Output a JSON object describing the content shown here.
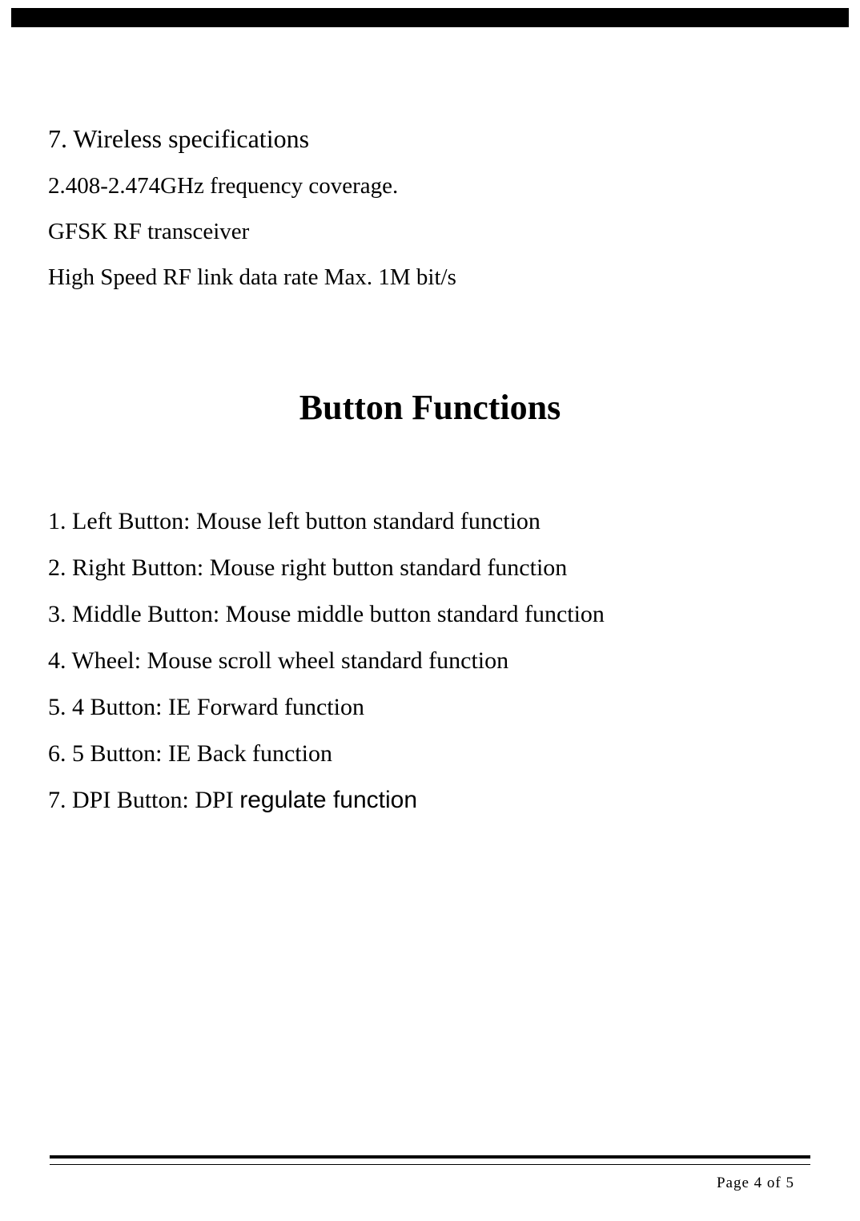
{
  "section": {
    "heading": "7. Wireless specifications",
    "specs": [
      "2.408-2.474GHz frequency coverage.",
      "GFSK RF transceiver",
      "High Speed RF link data rate Max. 1M bit/s"
    ]
  },
  "title": "Button Functions",
  "functions": [
    {
      "text": "1. Left Button: Mouse left button standard function",
      "indent": false
    },
    {
      "text": "2. Right Button: Mouse right button standard function",
      "indent": false
    },
    {
      "text": "3. Middle Button: Mouse middle button standard function",
      "indent": false
    },
    {
      "text": "4. Wheel: Mouse scroll wheel standard function",
      "indent": false
    },
    {
      "text": "5.    4 Button:  IE  Forward function",
      "indent": false
    },
    {
      "text": "6.    5 Button: IE Back function",
      "indent": false
    },
    {
      "prefix": "7.    DPI Button: DPI ",
      "suffix": "regulate function",
      "indent": false,
      "mixed": true
    }
  ],
  "footer": "Page  4  of  5"
}
